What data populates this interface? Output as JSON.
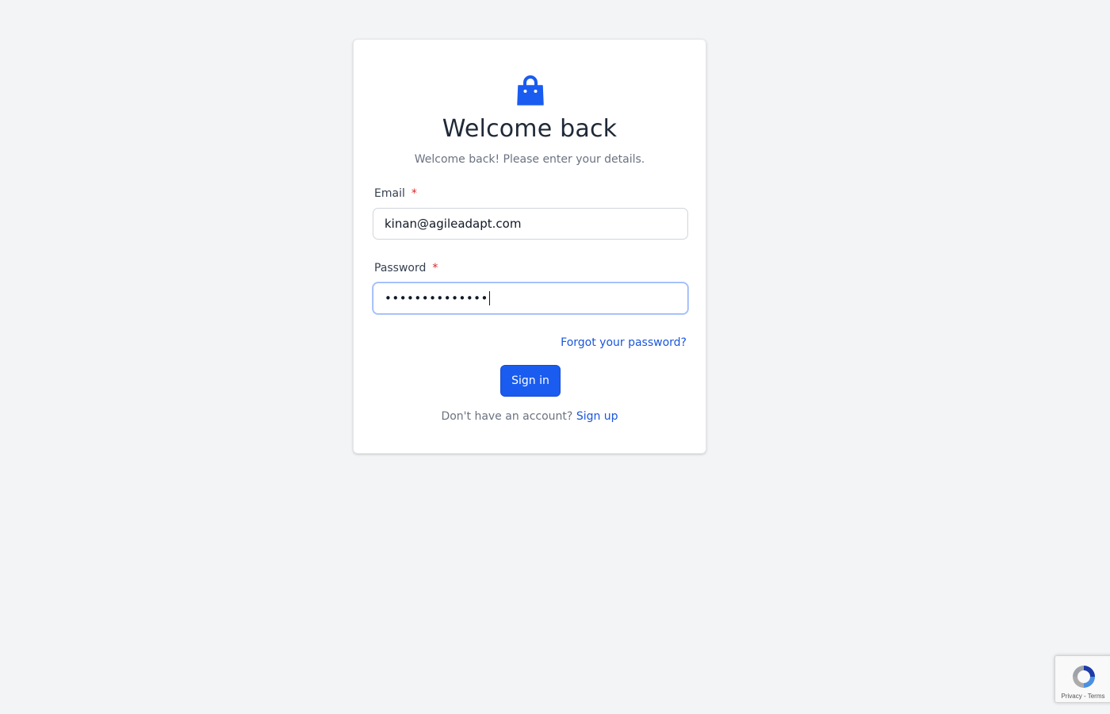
{
  "card": {
    "title": "Welcome back",
    "subtitle": "Welcome back! Please enter your details."
  },
  "form": {
    "email": {
      "label": "Email",
      "required_mark": "*",
      "value": "kinan@agileadapt.com"
    },
    "password": {
      "label": "Password",
      "required_mark": "*",
      "value": "••••••••••••••"
    },
    "forgot_link": "Forgot your password?",
    "submit_label": "Sign in",
    "signup_prompt": "Don't have an account?",
    "signup_link": "Sign up"
  },
  "recaptcha": {
    "privacy": "Privacy",
    "separator": " - ",
    "terms": "Terms"
  },
  "colors": {
    "accent": "#1a5cf0",
    "link": "#1a56db",
    "required": "#dc2626",
    "background": "#f3f4f6"
  },
  "icons": {
    "logo": "shopping-bag-icon",
    "recaptcha": "recaptcha-logo-icon"
  }
}
